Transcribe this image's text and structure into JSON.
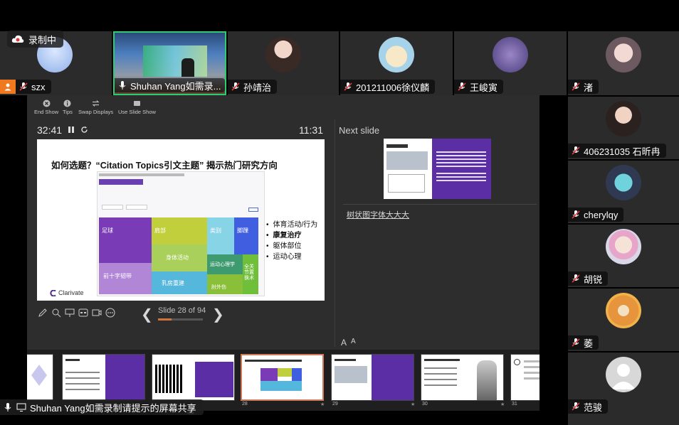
{
  "recording": {
    "label": "录制中"
  },
  "top_participants": [
    {
      "name": "szx"
    },
    {
      "name": "Shuhan Yang如需录..."
    },
    {
      "name": "孙靖治"
    },
    {
      "name": "201211006徐仪麟"
    },
    {
      "name": "王峻寅"
    },
    {
      "name": "渚"
    }
  ],
  "right_participants": [
    {
      "name": "406231035 石昕冉"
    },
    {
      "name": "cherylqy"
    },
    {
      "name": "胡锐"
    },
    {
      "name": "萎"
    },
    {
      "name": "范骏"
    }
  ],
  "toolbar": {
    "end_show": "End Show",
    "tips": "Tips",
    "swap_displays": "Swap Displays",
    "use_slide_show": "Use Slide Show"
  },
  "elapsed": "32:41",
  "clock": "11:31",
  "next_slide_label": "Next slide",
  "current_slide": {
    "title": "如何选题？“Citation Topics引文主题” 揭示热门研究方向",
    "bullets": [
      "体育活动/行为",
      "康复治疗",
      "躯体部位",
      "运动心理"
    ],
    "brand": "Clarivate",
    "treemap_blocks": [
      "足球",
      "肩部",
      "类别",
      "脚踝",
      "身体活动",
      "运动心理学",
      "全关节置换术",
      "肘外伤",
      "前十字韧带",
      "乳房重建"
    ]
  },
  "notes": "树状图字体大大大",
  "slide_counter": "Slide 28 of 94",
  "progress": 0.298,
  "font_size_controls": [
    "A",
    "A"
  ],
  "filmstrip": {
    "numbers": [
      "28",
      "29",
      "30",
      "31"
    ]
  },
  "share_banner": "Shuhan Yang如需录制请提示的屏幕共享",
  "colors": {
    "tile_bg": "#2b2b2b",
    "accent_purple": "#5b2ea6",
    "active_border": "#d07a5a",
    "presenter_border": "#2ecc71",
    "muted_red": "#e03b3b"
  }
}
